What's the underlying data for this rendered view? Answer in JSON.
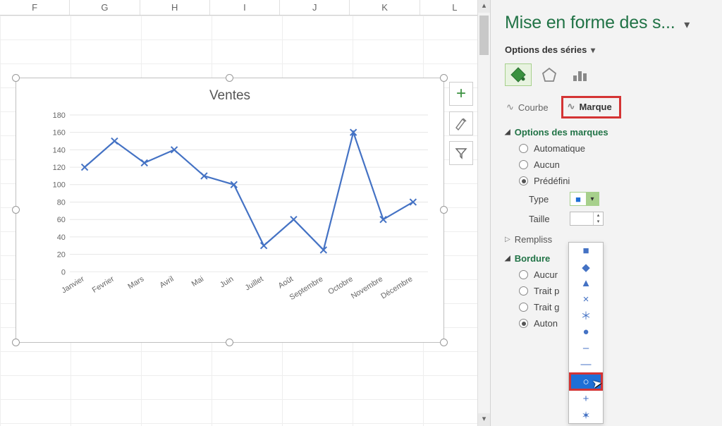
{
  "columns": [
    "F",
    "G",
    "H",
    "I",
    "J",
    "K",
    "L"
  ],
  "chart_data": {
    "type": "line",
    "title": "Ventes",
    "categories": [
      "Janvier",
      "Fevrier",
      "Mars",
      "Avril",
      "Mai",
      "Juin",
      "Juillet",
      "Août",
      "Septembre",
      "Octobre",
      "Novembre",
      "Décembre"
    ],
    "values": [
      120,
      150,
      125,
      140,
      110,
      100,
      30,
      60,
      25,
      160,
      60,
      80
    ],
    "ylim": [
      0,
      180
    ],
    "ytick_step": 20,
    "marker_style": "x"
  },
  "side_buttons": {
    "add": "+",
    "brush": "✎",
    "filter": "▼"
  },
  "pane": {
    "title": "Mise en forme des s...",
    "subtitle": "Options des séries",
    "tabs": {
      "line": "Courbe",
      "marker": "Marque"
    },
    "sections": {
      "marker_options": "Options des marques",
      "fill": "Rempliss",
      "border": "Bordure"
    },
    "marker_radios": {
      "auto": "Automatique",
      "none": "Aucun",
      "preset": "Prédéfini",
      "selected": "preset"
    },
    "fields": {
      "type": "Type",
      "size": "Taille"
    },
    "border_radios": {
      "none": "Aucur",
      "solid": "Trait p",
      "gradient": "Trait g",
      "auto": "Auton",
      "selected": "auto"
    },
    "marker_types": [
      "■",
      "◆",
      "▲",
      "×",
      "＊",
      "●",
      "–",
      "—",
      "○",
      "+",
      "✶"
    ]
  }
}
